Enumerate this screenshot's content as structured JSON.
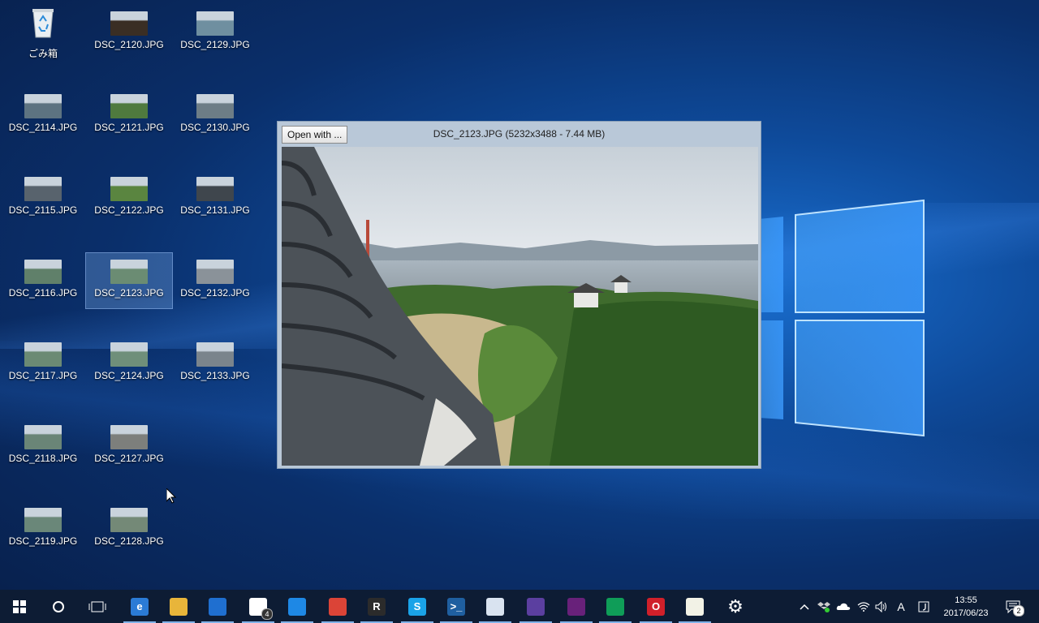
{
  "desktop": {
    "icons": [
      {
        "label": "ごみ箱",
        "type": "recycle-bin",
        "selected": false
      },
      {
        "label": "DSC_2120.JPG",
        "type": "photo",
        "tone": "#3a2e24",
        "selected": false
      },
      {
        "label": "DSC_2129.JPG",
        "type": "photo",
        "tone": "#6f8fa0",
        "selected": false
      },
      {
        "label": "DSC_2114.JPG",
        "type": "photo",
        "tone": "#5d7381",
        "selected": false
      },
      {
        "label": "DSC_2121.JPG",
        "type": "photo",
        "tone": "#4f7a3e",
        "selected": false
      },
      {
        "label": "DSC_2130.JPG",
        "type": "photo",
        "tone": "#6d7d86",
        "selected": false
      },
      {
        "label": "DSC_2115.JPG",
        "type": "photo",
        "tone": "#58636d",
        "selected": false
      },
      {
        "label": "DSC_2122.JPG",
        "type": "photo",
        "tone": "#5a8540",
        "selected": false
      },
      {
        "label": "DSC_2131.JPG",
        "type": "photo",
        "tone": "#3f464d",
        "selected": false
      },
      {
        "label": "DSC_2116.JPG",
        "type": "photo",
        "tone": "#60806a",
        "selected": false
      },
      {
        "label": "DSC_2123.JPG",
        "type": "photo",
        "tone": "#6b8c73",
        "selected": true
      },
      {
        "label": "DSC_2132.JPG",
        "type": "photo",
        "tone": "#8a9299",
        "selected": false
      },
      {
        "label": "DSC_2117.JPG",
        "type": "photo",
        "tone": "#6b8a74",
        "selected": false
      },
      {
        "label": "DSC_2124.JPG",
        "type": "photo",
        "tone": "#6f8f7a",
        "selected": false
      },
      {
        "label": "DSC_2133.JPG",
        "type": "photo",
        "tone": "#7a848c",
        "selected": false
      },
      {
        "label": "DSC_2118.JPG",
        "type": "photo",
        "tone": "#6a8577",
        "selected": false
      },
      {
        "label": "DSC_2127.JPG",
        "type": "photo",
        "tone": "#7d7f7c",
        "selected": false
      },
      {
        "label": "DSC_2119.JPG",
        "type": "photo",
        "tone": "#6a8779",
        "selected": false
      },
      {
        "label": "DSC_2128.JPG",
        "type": "photo",
        "tone": "#748977",
        "selected": false
      }
    ]
  },
  "viewer": {
    "open_with_label": "Open with ...",
    "title": "DSC_2123.JPG (5232x3488 - 7.44 MB)"
  },
  "taskbar": {
    "apps": [
      {
        "name": "start-button",
        "icon": "windows-icon"
      },
      {
        "name": "cortana-button",
        "icon": "search-circle-icon"
      },
      {
        "name": "task-view-button",
        "icon": "task-view-icon"
      },
      {
        "name": "taskbar-edge",
        "icon": "edge-icon",
        "color": "#2b7bd6",
        "glyph": "e"
      },
      {
        "name": "taskbar-file-explorer",
        "icon": "folder-icon",
        "color": "#e8b53a",
        "glyph": ""
      },
      {
        "name": "taskbar-store",
        "icon": "store-icon",
        "color": "#1f6fd0",
        "glyph": ""
      },
      {
        "name": "taskbar-mail",
        "icon": "mail-icon",
        "color": "#ffffff",
        "glyph": "",
        "badge": "4"
      },
      {
        "name": "taskbar-viewer",
        "icon": "image-viewer-icon",
        "color": "#1e88e5",
        "glyph": ""
      },
      {
        "name": "taskbar-chrome",
        "icon": "chrome-icon",
        "color": "#db4437",
        "glyph": ""
      },
      {
        "name": "taskbar-r-app",
        "icon": "r-app-icon",
        "color": "#2b2b2b",
        "glyph": "R"
      },
      {
        "name": "taskbar-skype",
        "icon": "skype-icon",
        "color": "#1aa3e8",
        "glyph": "S"
      },
      {
        "name": "taskbar-powershell",
        "icon": "powershell-icon",
        "color": "#1f5fa0",
        "glyph": ">_"
      },
      {
        "name": "taskbar-paint",
        "icon": "paint-icon",
        "color": "#d9e3f0",
        "glyph": ""
      },
      {
        "name": "taskbar-cat-app",
        "icon": "cat-icon",
        "color": "#5b3fa0",
        "glyph": ""
      },
      {
        "name": "taskbar-visual-studio",
        "icon": "visual-studio-icon",
        "color": "#68217a",
        "glyph": ""
      },
      {
        "name": "taskbar-chrome-2",
        "icon": "chrome-icon",
        "color": "#0f9d58",
        "glyph": ""
      },
      {
        "name": "taskbar-opera",
        "icon": "opera-icon",
        "color": "#d0202a",
        "glyph": "O"
      },
      {
        "name": "taskbar-notepad",
        "icon": "notepad-icon",
        "color": "#f2f2e6",
        "glyph": ""
      },
      {
        "name": "taskbar-settings",
        "icon": "gear-icon",
        "color": "#ffffff",
        "glyph": "⚙"
      }
    ],
    "tray": {
      "chevron": "^",
      "ime": "A",
      "time": "13:55",
      "date": "2017/06/23",
      "notifications_badge": "2"
    }
  },
  "colors": {
    "taskbar_bg": "#0d1c34",
    "desktop_blue": "#0e4a9a",
    "selection": "#78aae6"
  }
}
